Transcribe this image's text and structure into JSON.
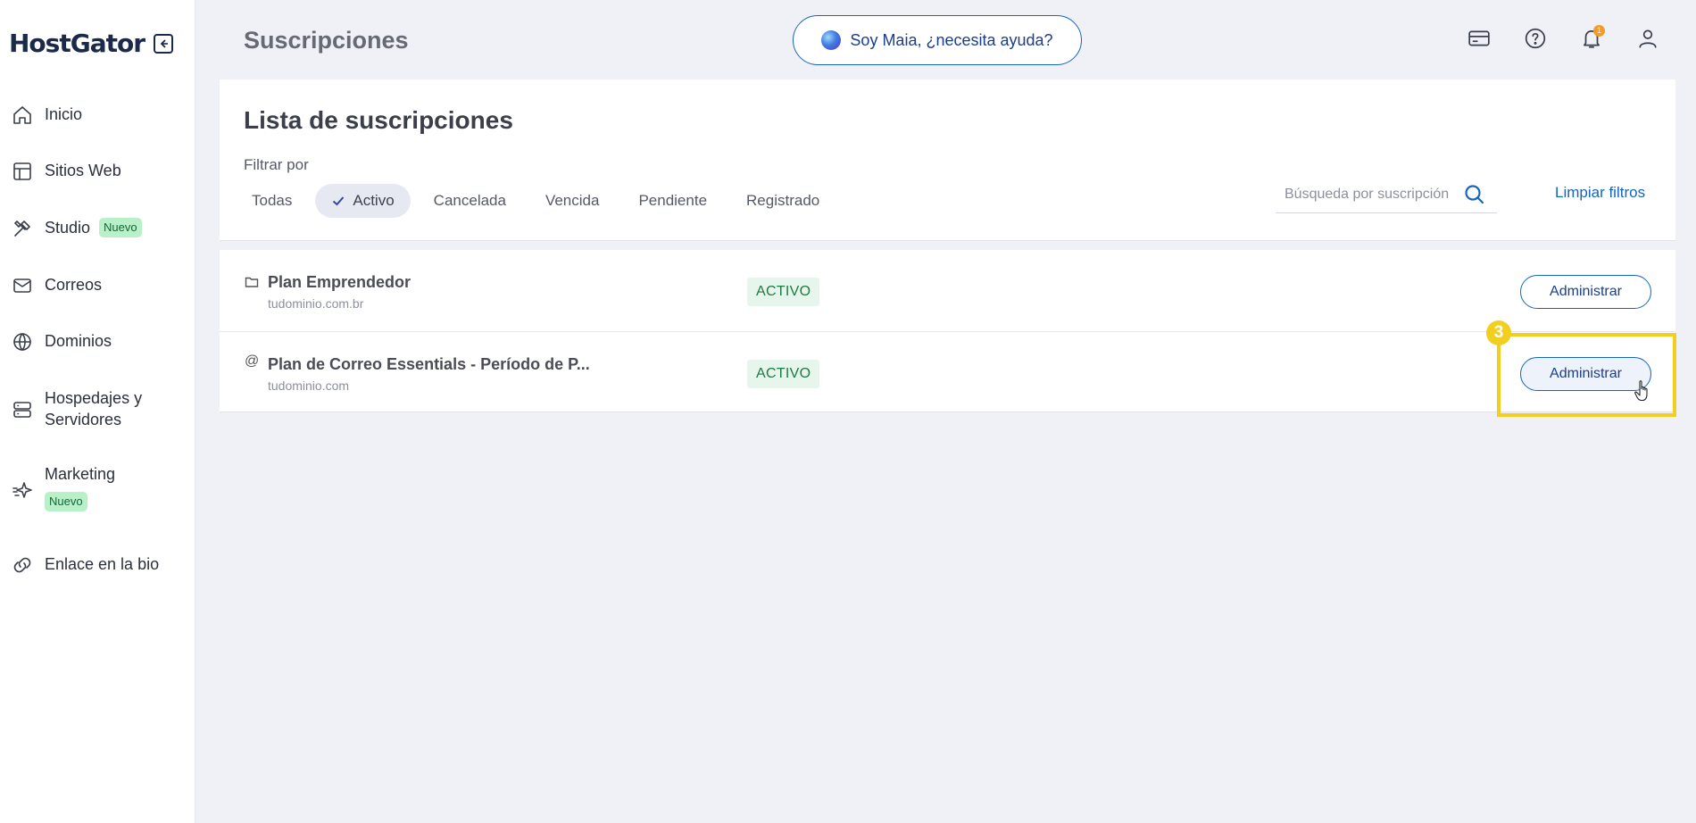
{
  "brand": {
    "logo": "HostGator"
  },
  "sidebar": {
    "items": [
      {
        "label": "Inicio",
        "icon": "home-icon"
      },
      {
        "label": "Sitios Web",
        "icon": "layout-icon"
      },
      {
        "label": "Studio",
        "icon": "tools-icon",
        "badge": "Nuevo"
      },
      {
        "label": "Correos",
        "icon": "mail-icon"
      },
      {
        "label": "Dominios",
        "icon": "globe-icon"
      },
      {
        "label": "Hospedajes y Servidores",
        "icon": "server-icon"
      },
      {
        "label": "Marketing",
        "icon": "sparkle-icon",
        "badge": "Nuevo"
      },
      {
        "label": "Enlace en la bio",
        "icon": "link-icon"
      }
    ]
  },
  "header": {
    "title": "Suscripciones",
    "assistant_label": "Soy Maia, ¿necesita ayuda?",
    "notification_count": "1",
    "icons": [
      "card-icon",
      "help-icon",
      "bell-icon",
      "user-icon"
    ]
  },
  "filters": {
    "card_title": "Lista de suscripciones",
    "filter_label": "Filtrar por",
    "chips": [
      "Todas",
      "Activo",
      "Cancelada",
      "Vencida",
      "Pendiente",
      "Registrado"
    ],
    "selected": "Activo",
    "search_placeholder": "Búsqueda por suscripción",
    "clear_label": "Limpiar filtros"
  },
  "subscriptions": [
    {
      "icon": "folder-icon",
      "name": "Plan Emprendedor",
      "domain": "tudominio.com.br",
      "status": "ACTIVO",
      "action": "Administrar"
    },
    {
      "icon": "at-icon",
      "icon_glyph": "@",
      "name": "Plan de Correo Essentials - Período de P...",
      "domain": "tudominio.com",
      "status": "ACTIVO",
      "action": "Administrar"
    }
  ],
  "tutorial": {
    "step": "3",
    "highlight_color": "#f2cf1e"
  },
  "colors": {
    "accent": "#1565c0",
    "status_bg": "#e7f6ec",
    "status_text": "#1e7a3f",
    "badge_bg": "#b8f0c8"
  }
}
